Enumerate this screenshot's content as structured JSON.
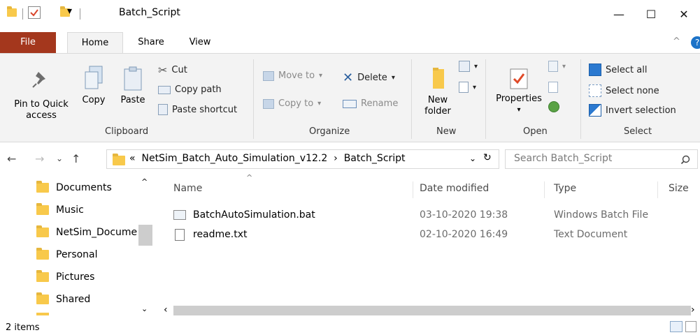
{
  "window": {
    "title": "Batch_Script",
    "minimize_glyph": "—",
    "maximize_glyph": "☐",
    "close_glyph": "✕"
  },
  "ribbon_tabs": {
    "file": "File",
    "home": "Home",
    "share": "Share",
    "view": "View",
    "collapse_glyph": "^",
    "help_glyph": "?"
  },
  "ribbon": {
    "clipboard": {
      "label": "Clipboard",
      "pin_label_1": "Pin to Quick",
      "pin_label_2": "access",
      "copy": "Copy",
      "paste": "Paste",
      "cut": "Cut",
      "copy_path": "Copy path",
      "paste_shortcut": "Paste shortcut"
    },
    "organize": {
      "label": "Organize",
      "move_to": "Move to",
      "copy_to": "Copy to",
      "delete": "Delete",
      "rename": "Rename"
    },
    "new": {
      "label": "New",
      "new_folder_1": "New",
      "new_folder_2": "folder"
    },
    "open": {
      "label": "Open",
      "properties": "Properties"
    },
    "select": {
      "label": "Select",
      "select_all": "Select all",
      "select_none": "Select none",
      "invert_selection": "Invert selection"
    }
  },
  "address": {
    "overflow": "«",
    "crumbs": [
      "NetSim_Batch_Auto_Simulation_v12.2",
      "Batch_Script"
    ],
    "separator": "›",
    "search_placeholder": "Search Batch_Script"
  },
  "nav_pane": {
    "items": [
      "Documents",
      "Music",
      "NetSim_Docume",
      "Personal",
      "Pictures",
      "Shared"
    ]
  },
  "file_list": {
    "columns": [
      "Name",
      "Date modified",
      "Type",
      "Size"
    ],
    "rows": [
      {
        "name": "BatchAutoSimulation.bat",
        "date": "03-10-2020 19:38",
        "type": "Windows Batch File",
        "icon": "batch-file-icon"
      },
      {
        "name": "readme.txt",
        "date": "02-10-2020 16:49",
        "type": "Text Document",
        "icon": "text-file-icon"
      }
    ]
  },
  "status": {
    "items_count": "2 items"
  },
  "colors": {
    "file_tab": "#a4371d",
    "folder": "#f8c94b",
    "accent_blue": "#1c73c8",
    "ribbon_bg": "#f3f3f3"
  }
}
